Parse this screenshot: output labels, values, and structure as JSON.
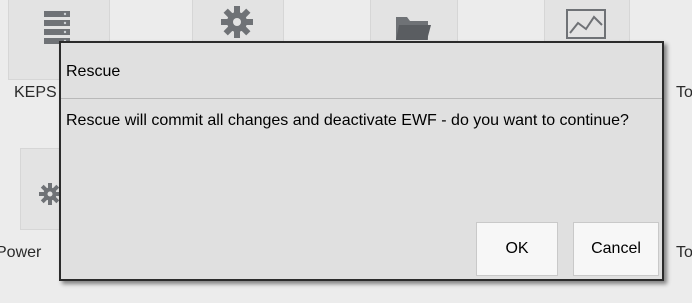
{
  "background": {
    "labels": {
      "left_top": "KEPS",
      "left_bottom": "Power",
      "right_top": "To",
      "right_bottom": "To"
    },
    "icons": [
      "server-icon",
      "gear-icon",
      "folder-icon",
      "chart-icon",
      "gear-icon"
    ]
  },
  "dialog": {
    "title": "Rescue",
    "message": "Rescue will commit all changes and deactivate EWF - do you want to continue?",
    "ok_label": "OK",
    "cancel_label": "Cancel"
  }
}
